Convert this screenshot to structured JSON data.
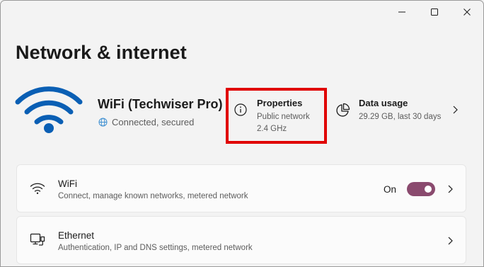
{
  "window": {
    "controls": [
      "minimize-icon",
      "maximize-icon",
      "close-icon"
    ]
  },
  "page": {
    "title": "Network & internet"
  },
  "connection": {
    "name": "WiFi (Techwiser Pro)",
    "status": "Connected, secured",
    "icon": "wifi-icon",
    "status_icon": "globe-icon"
  },
  "properties": {
    "title": "Properties",
    "network_type": "Public network",
    "band": "2.4 GHz",
    "icon": "info-icon",
    "highlight_color": "#e00000"
  },
  "data_usage": {
    "title": "Data usage",
    "detail": "29.29 GB, last 30 days",
    "icon": "pie-chart-icon"
  },
  "settings": {
    "wifi": {
      "title": "WiFi",
      "description": "Connect, manage known networks, metered network",
      "toggle_label": "On",
      "toggle_on": true,
      "icon": "wifi-icon"
    },
    "ethernet": {
      "title": "Ethernet",
      "description": "Authentication, IP and DNS settings, metered network",
      "icon": "ethernet-icon"
    }
  },
  "colors": {
    "accent": "#8a4a6e",
    "wifi_blue": "#0a5fb4",
    "background": "#f3f3f3"
  }
}
